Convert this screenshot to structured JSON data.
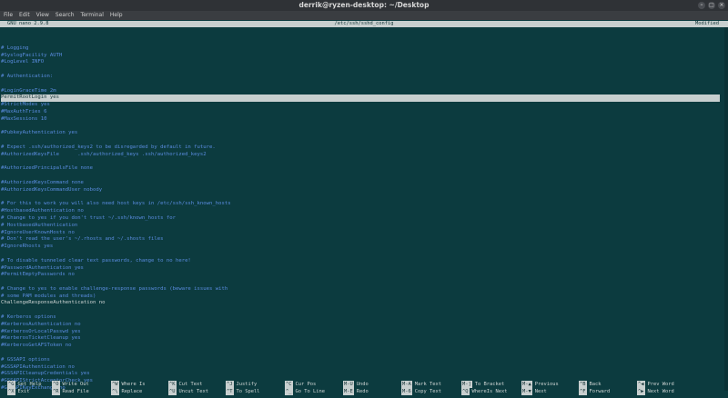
{
  "window": {
    "title": "derrik@ryzen-desktop: ~/Desktop",
    "buttons": [
      "–",
      "□",
      "×"
    ]
  },
  "menu": [
    "File",
    "Edit",
    "View",
    "Search",
    "Terminal",
    "Help"
  ],
  "nano": {
    "version": "GNU nano 2.9.8",
    "filename": "/etc/ssh/sshd_config",
    "status": "Modified"
  },
  "lines": [
    {
      "t": "",
      "k": "comment"
    },
    {
      "t": "# Logging",
      "k": "comment"
    },
    {
      "t": "#SyslogFacility AUTH",
      "k": "comment"
    },
    {
      "t": "#LogLevel INFO",
      "k": "comment"
    },
    {
      "t": "",
      "k": "comment"
    },
    {
      "t": "# Authentication:",
      "k": "comment"
    },
    {
      "t": "",
      "k": "comment"
    },
    {
      "t": "#LoginGraceTime 2m",
      "k": "comment"
    },
    {
      "t": "PermitRootLogin yes",
      "k": "sel"
    },
    {
      "t": "#StrictModes yes",
      "k": "comment"
    },
    {
      "t": "#MaxAuthTries 6",
      "k": "comment"
    },
    {
      "t": "#MaxSessions 10",
      "k": "comment"
    },
    {
      "t": "",
      "k": "comment"
    },
    {
      "t": "#PubkeyAuthentication yes",
      "k": "comment"
    },
    {
      "t": "",
      "k": "comment"
    },
    {
      "t": "# Expect .ssh/authorized_keys2 to be disregarded by default in future.",
      "k": "comment"
    },
    {
      "t": "#AuthorizedKeysFile      .ssh/authorized_keys .ssh/authorized_keys2",
      "k": "comment"
    },
    {
      "t": "",
      "k": "comment"
    },
    {
      "t": "#AuthorizedPrincipalsFile none",
      "k": "comment"
    },
    {
      "t": "",
      "k": "comment"
    },
    {
      "t": "#AuthorizedKeysCommand none",
      "k": "comment"
    },
    {
      "t": "#AuthorizedKeysCommandUser nobody",
      "k": "comment"
    },
    {
      "t": "",
      "k": "comment"
    },
    {
      "t": "# For this to work you will also need host keys in /etc/ssh/ssh_known_hosts",
      "k": "comment"
    },
    {
      "t": "#HostbasedAuthentication no",
      "k": "comment"
    },
    {
      "t": "# Change to yes if you don't trust ~/.ssh/known_hosts for",
      "k": "comment"
    },
    {
      "t": "# HostbasedAuthentication",
      "k": "comment"
    },
    {
      "t": "#IgnoreUserKnownHosts no",
      "k": "comment"
    },
    {
      "t": "# Don't read the user's ~/.rhosts and ~/.shosts files",
      "k": "comment"
    },
    {
      "t": "#IgnoreRhosts yes",
      "k": "comment"
    },
    {
      "t": "",
      "k": "comment"
    },
    {
      "t": "# To disable tunneled clear text passwords, change to no here!",
      "k": "comment"
    },
    {
      "t": "#PasswordAuthentication yes",
      "k": "comment"
    },
    {
      "t": "#PermitEmptyPasswords no",
      "k": "comment"
    },
    {
      "t": "",
      "k": "comment"
    },
    {
      "t": "# Change to yes to enable challenge-response passwords (beware issues with",
      "k": "comment"
    },
    {
      "t": "# some PAM modules and threads)",
      "k": "comment"
    },
    {
      "t": "ChallengeResponseAuthentication no",
      "k": "code"
    },
    {
      "t": "",
      "k": "comment"
    },
    {
      "t": "# Kerberos options",
      "k": "comment"
    },
    {
      "t": "#KerberosAuthentication no",
      "k": "comment"
    },
    {
      "t": "#KerberosOrLocalPasswd yes",
      "k": "comment"
    },
    {
      "t": "#KerberosTicketCleanup yes",
      "k": "comment"
    },
    {
      "t": "#KerberosGetAFSToken no",
      "k": "comment"
    },
    {
      "t": "",
      "k": "comment"
    },
    {
      "t": "# GSSAPI options",
      "k": "comment"
    },
    {
      "t": "#GSSAPIAuthentication no",
      "k": "comment"
    },
    {
      "t": "#GSSAPICleanupCredentials yes",
      "k": "comment"
    },
    {
      "t": "#GSSAPIStrictAcceptorCheck yes",
      "k": "comment"
    },
    {
      "t": "#GSSAPIKeyExchange no",
      "k": "comment"
    }
  ],
  "shortcuts": {
    "row1": [
      {
        "key": "^G",
        "label": "Get Help"
      },
      {
        "key": "^O",
        "label": "Write Out"
      },
      {
        "key": "^W",
        "label": "Where Is"
      },
      {
        "key": "^K",
        "label": "Cut Text"
      },
      {
        "key": "^J",
        "label": "Justify"
      },
      {
        "key": "^C",
        "label": "Cur Pos"
      },
      {
        "key": "M-U",
        "label": "Undo"
      },
      {
        "key": "M-A",
        "label": "Mark Text"
      },
      {
        "key": "M-]",
        "label": "To Bracket"
      },
      {
        "key": "M-▲",
        "label": "Previous"
      },
      {
        "key": "^B",
        "label": "Back"
      },
      {
        "key": "^◀",
        "label": "Prev Word"
      }
    ],
    "row2": [
      {
        "key": "^X",
        "label": "Exit"
      },
      {
        "key": "^R",
        "label": "Read File"
      },
      {
        "key": "^\\",
        "label": "Replace"
      },
      {
        "key": "^U",
        "label": "Uncut Text"
      },
      {
        "key": "^T",
        "label": "To Spell"
      },
      {
        "key": "^_",
        "label": "Go To Line"
      },
      {
        "key": "M-E",
        "label": "Redo"
      },
      {
        "key": "M-6",
        "label": "Copy Text"
      },
      {
        "key": "^Q",
        "label": "WhereIs Next"
      },
      {
        "key": "M-▼",
        "label": "Next"
      },
      {
        "key": "^F",
        "label": "Forward"
      },
      {
        "key": "^▶",
        "label": "Next Word"
      }
    ]
  }
}
